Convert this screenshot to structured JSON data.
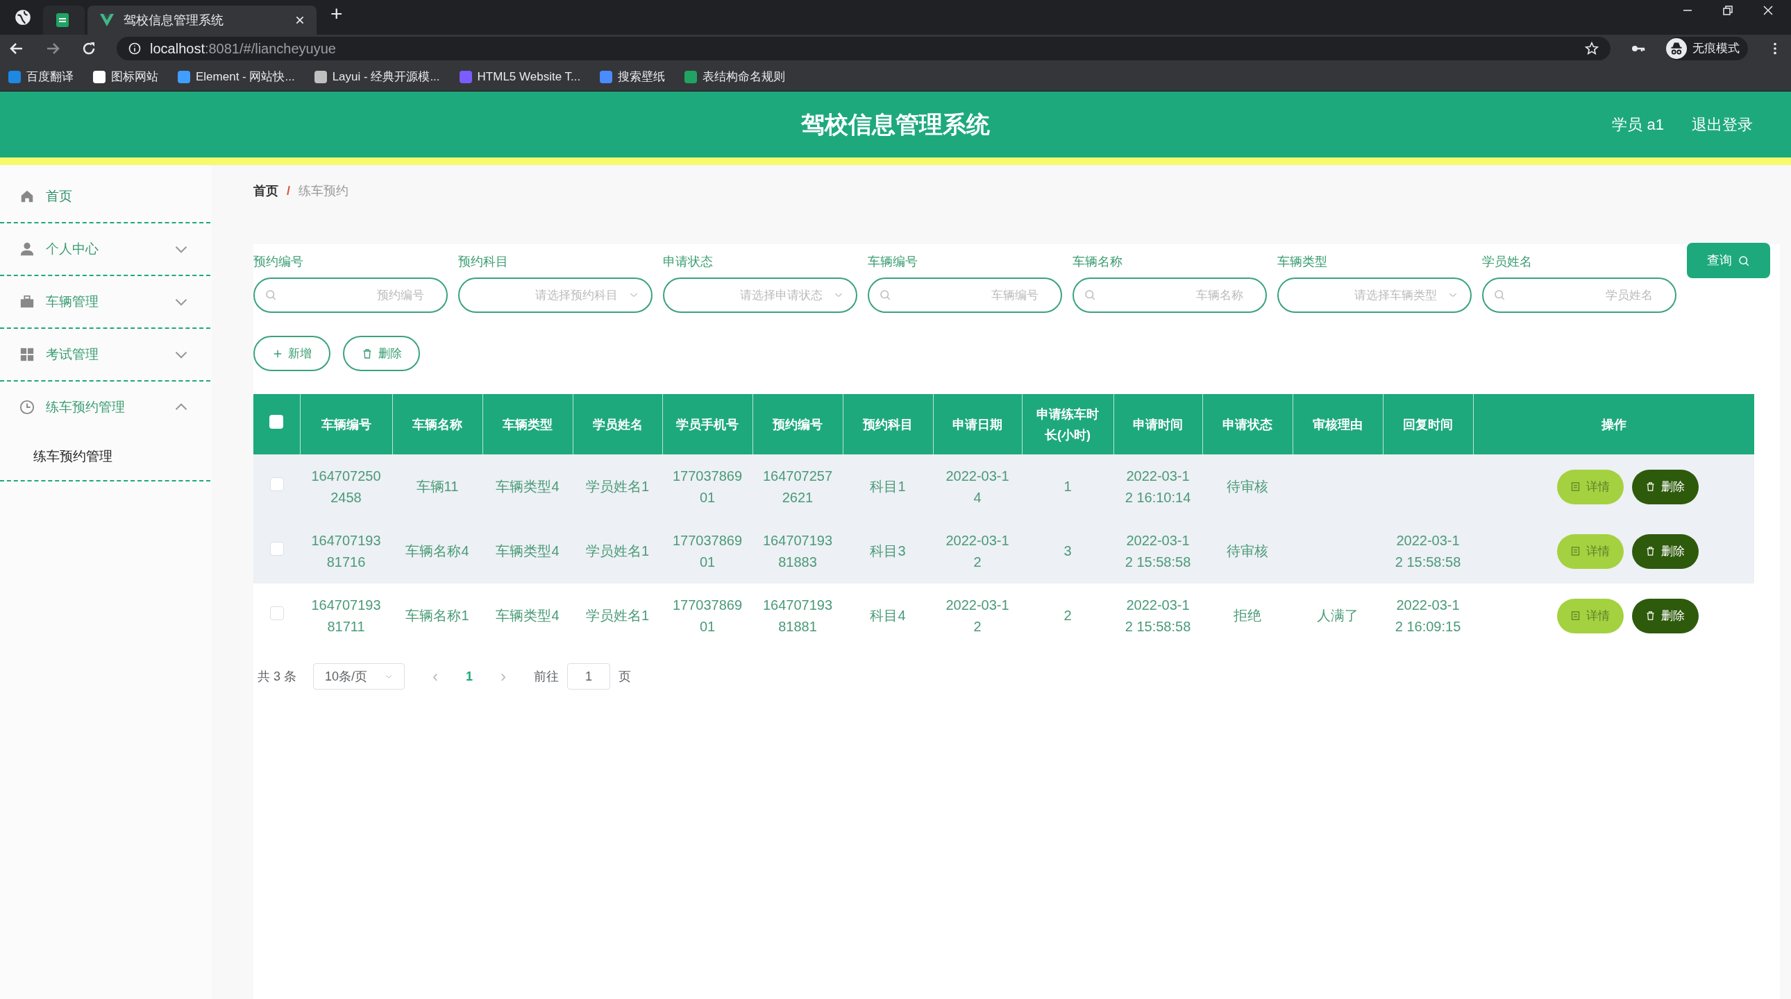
{
  "browser": {
    "tabs": [
      {
        "kind": "pinned",
        "selected": false
      },
      {
        "title": "驾校信息管理系统",
        "kind": "page",
        "selected": true
      }
    ],
    "new_tab": "+",
    "address": {
      "host": "localhost",
      "path": ":8081/#/liancheyuyue"
    },
    "profile": "无痕模式",
    "bookmarks": [
      {
        "label": "百度翻译",
        "color": "#1e88e5"
      },
      {
        "label": "图标网站",
        "color": "#ffffff"
      },
      {
        "label": "Element - 网站快...",
        "color": "#409eff"
      },
      {
        "label": "Layui - 经典开源模...",
        "color": "#c0c0c0"
      },
      {
        "label": "HTML5 Website T...",
        "color": "#7b5cff"
      },
      {
        "label": "搜索壁纸",
        "color": "#4a8cff"
      },
      {
        "label": "表结构命名规则",
        "color": "#1fa463"
      }
    ]
  },
  "header": {
    "title": "驾校信息管理系统",
    "user": "学员 a1",
    "logout": "退出登录"
  },
  "sidebar": {
    "items": [
      {
        "label": "首页"
      },
      {
        "label": "个人中心",
        "expanded": false
      },
      {
        "label": "车辆管理",
        "expanded": false
      },
      {
        "label": "考试管理",
        "expanded": false
      },
      {
        "label": "练车预约管理",
        "expanded": true,
        "children": [
          {
            "label": "练车预约管理"
          }
        ]
      }
    ]
  },
  "breadcrumb": [
    "首页",
    "练车预约"
  ],
  "breadcrumb_separator": "/",
  "filters": [
    {
      "label": "预约编号",
      "kind": "search",
      "placeholder": "预约编号"
    },
    {
      "label": "预约科目",
      "kind": "select",
      "placeholder": "请选择预约科目"
    },
    {
      "label": "申请状态",
      "kind": "select",
      "placeholder": "请选择申请状态"
    },
    {
      "label": "车辆编号",
      "kind": "search",
      "placeholder": "车辆编号"
    },
    {
      "label": "车辆名称",
      "kind": "search",
      "placeholder": "车辆名称"
    },
    {
      "label": "车辆类型",
      "kind": "select",
      "placeholder": "请选择车辆类型"
    },
    {
      "label": "学员姓名",
      "kind": "search",
      "placeholder": "学员姓名"
    }
  ],
  "query_button": "查询",
  "actions": [
    {
      "label": "新增",
      "kind": "add"
    },
    {
      "label": "删除",
      "kind": "delete"
    }
  ],
  "table": {
    "select_all": {
      "checked": false
    },
    "columns": [
      "车辆编号",
      "车辆名称",
      "车辆类型",
      "学员姓名",
      "学员手机号",
      "预约编号",
      "预约科目",
      "申请日期",
      "申请练车时长(小时)",
      "申请时间",
      "申请状态",
      "审核理由",
      "回复时间",
      "操作"
    ],
    "rows": [
      {
        "checked": false,
        "shaded": true,
        "cells": [
          "1647072502458",
          "车辆11",
          "车辆类型4",
          "学员姓名1",
          "17703786901",
          "1647072572621",
          "科目1",
          "2022-03-14",
          "1",
          "2022-03-12 16:10:14",
          "待审核",
          "",
          ""
        ],
        "buttons": [
          "详情",
          "删除"
        ]
      },
      {
        "checked": false,
        "shaded": true,
        "cells": [
          "16470719381716",
          "车辆名称4",
          "车辆类型4",
          "学员姓名1",
          "17703786901",
          "16470719381883",
          "科目3",
          "2022-03-12",
          "3",
          "2022-03-12 15:58:58",
          "待审核",
          "",
          "2022-03-12 15:58:58"
        ],
        "buttons": [
          "详情",
          "删除"
        ]
      },
      {
        "checked": false,
        "shaded": false,
        "cells": [
          "16470719381711",
          "车辆名称1",
          "车辆类型4",
          "学员姓名1",
          "17703786901",
          "16470719381881",
          "科目4",
          "2022-03-12",
          "2",
          "2022-03-12 15:58:58",
          "拒绝",
          "人满了",
          "2022-03-12 16:09:15"
        ],
        "buttons": [
          "详情",
          "删除"
        ]
      }
    ]
  },
  "pagination": {
    "total": "共 3 条",
    "page_size": "10条/页",
    "prev": "‹",
    "pages": [
      {
        "label": "1",
        "selected": true
      }
    ],
    "next": "›",
    "goto_label": "前往",
    "goto_value": "1",
    "goto_suffix": "页"
  }
}
